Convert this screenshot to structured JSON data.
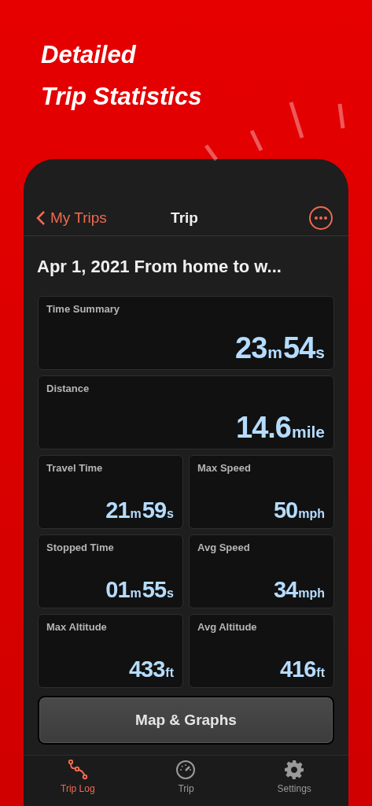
{
  "headline": [
    "Detailed",
    "Trip Statistics"
  ],
  "nav": {
    "back": "My Trips",
    "title": "Trip"
  },
  "trip_title": "Apr 1, 2021 From home to w...",
  "stats": [
    {
      "label": "Time Summary",
      "kind": "wide",
      "value": [
        {
          "text": "23",
          "kind": "number"
        },
        {
          "text": "m",
          "kind": "unit"
        },
        {
          "text": "54",
          "kind": "number"
        },
        {
          "text": "s",
          "kind": "unit"
        }
      ]
    },
    {
      "label": "Distance",
      "kind": "wide",
      "value": [
        {
          "text": "14.6",
          "kind": "number"
        },
        {
          "text": "mile",
          "kind": "unit"
        }
      ]
    },
    {
      "label": "Travel Time",
      "kind": "half",
      "value": [
        {
          "text": "21",
          "kind": "number"
        },
        {
          "text": "m",
          "kind": "unit"
        },
        {
          "text": "59",
          "kind": "number"
        },
        {
          "text": "s",
          "kind": "unit"
        }
      ]
    },
    {
      "label": "Max Speed",
      "kind": "half",
      "value": [
        {
          "text": "50",
          "kind": "number"
        },
        {
          "text": "mph",
          "kind": "unit"
        }
      ]
    },
    {
      "label": "Stopped Time",
      "kind": "half",
      "value": [
        {
          "text": "01",
          "kind": "number"
        },
        {
          "text": "m",
          "kind": "unit"
        },
        {
          "text": "55",
          "kind": "number"
        },
        {
          "text": "s",
          "kind": "unit"
        }
      ]
    },
    {
      "label": "Avg Speed",
      "kind": "half",
      "value": [
        {
          "text": "34",
          "kind": "number"
        },
        {
          "text": "mph",
          "kind": "unit"
        }
      ]
    },
    {
      "label": "Max Altitude",
      "kind": "half",
      "value": [
        {
          "text": "433",
          "kind": "number"
        },
        {
          "text": "ft",
          "kind": "unit"
        }
      ]
    },
    {
      "label": "Avg Altitude",
      "kind": "half",
      "value": [
        {
          "text": "416",
          "kind": "number"
        },
        {
          "text": "ft",
          "kind": "unit"
        }
      ]
    }
  ],
  "button": "Map & Graphs",
  "tabs": [
    {
      "label": "Trip Log",
      "selected": true
    },
    {
      "label": "Trip",
      "selected": false
    },
    {
      "label": "Settings",
      "selected": false
    }
  ]
}
